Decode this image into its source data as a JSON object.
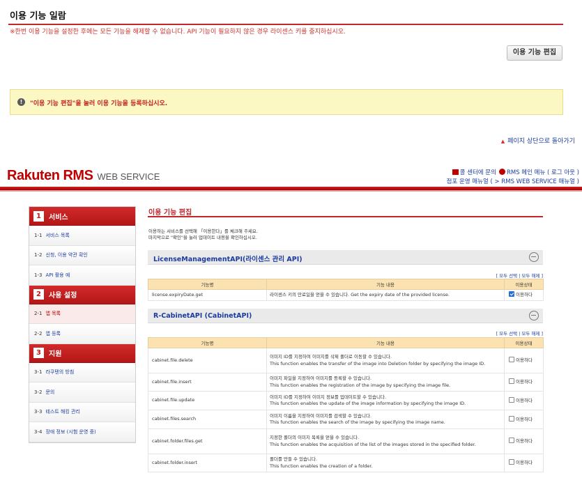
{
  "top": {
    "title": "이용 기능 일람",
    "warning": "※한번 이용 기능을 설정한 후에는 모든 기능을 해제할 수 없습니다. API 기능이 필요하지 않은 경우 라이센스 키를 중지하십시오.",
    "edit_button": "이용 기능 편집",
    "notice": "\"이용 기능 편집\"을 눌러 이용 기능을 등록하십시오.",
    "back_to_top": "페이지 상단으로 돌아가기"
  },
  "header": {
    "logo_main": "Rakuten RMS",
    "logo_sub": "WEB SERVICE",
    "link_callcenter": "콜 센터에 문의",
    "link_rms_main": "RMS 메인 메뉴 ( 로그 아웃 )",
    "link_manual": "점포 운영 매뉴얼",
    "link_ws_manual": "( > RMS WEB SERVICE 매뉴얼 )",
    "accent_color": "#bf0000"
  },
  "sidebar": {
    "sections": [
      {
        "num": "1",
        "title": "서비스",
        "items": [
          {
            "num": "1-1",
            "label": "서비스 목록"
          },
          {
            "num": "1-2",
            "label": "신청, 이용 약관 확인"
          },
          {
            "num": "1-3",
            "label": "API 활용 예"
          }
        ]
      },
      {
        "num": "2",
        "title": "사용 설정",
        "items": [
          {
            "num": "2-1",
            "label": "앱 목록"
          },
          {
            "num": "2-2",
            "label": "앱 등록"
          }
        ]
      },
      {
        "num": "3",
        "title": "지원",
        "items": [
          {
            "num": "3-1",
            "label": "라쿠텐의 방침"
          },
          {
            "num": "3-2",
            "label": "문의"
          },
          {
            "num": "3-3",
            "label": "테스트 해킹 관리"
          },
          {
            "num": "3-4",
            "label": "장애 정보 (시험 운영 중)"
          }
        ]
      }
    ]
  },
  "main": {
    "title": "이용 기능 편집",
    "intro_line1": "이용하는 서비스를 선택해 「이용한다」를 체크해 주세요.",
    "intro_line2": "마지막으로 \"확인\"을 눌러 업데이트 내용을 확인하십시오.",
    "select_links": "[ 모두 선택 | 모두 해제 ]",
    "col_function": "기능명",
    "col_desc": "기능 내용",
    "col_status": "이용상태",
    "use_label": "이용하다",
    "apis": [
      {
        "name": "LicenseManagementAPI(라이센스 관리 API)",
        "rows": [
          {
            "fn": "license.expiryDate.get",
            "desc": "라이센스 키의 만료일을 얻을 수 있습니다. Get the expiry date of the provided license.",
            "checked": true
          }
        ]
      },
      {
        "name": "R-CabinetAPI (CabinetAPI)",
        "rows": [
          {
            "fn": "cabinet.file.delete",
            "desc": "이미지 ID를 지정하여 이미지를 삭제 폴더로 이동할 수 있습니다.\nThis function enables the transfer of the image into Deletion folder by specifying the image ID.",
            "checked": false
          },
          {
            "fn": "cabinet.file.insert",
            "desc": "이미지 파일을 지정하여 이미지를 등록할 수 있습니다.\nThis function enables the registration of the image by specifying the image file.",
            "checked": false
          },
          {
            "fn": "cabinet.file.update",
            "desc": "이미지 ID를 지정하여 이미지 정보를 업데이트할 수 있습니다.\nThis function enables the update of the image information by specifying the image ID.",
            "checked": false
          },
          {
            "fn": "cabinet.files.search",
            "desc": "이미지 이름을 지정하여 이미지를 검색할 수 있습니다.\nThis function enables the search of the image by specifying the image name.",
            "checked": false
          },
          {
            "fn": "cabinet.folder.files.get",
            "desc": "지정한 폴더의 이미지 목록을 얻을 수 있습니다.\nThis function enables the acquisition of the list of the images stored in the specified folder.",
            "checked": false
          },
          {
            "fn": "cabinet.folder.insert",
            "desc": "폴더를 만들 수 있습니다.\nThis function enables the creation of a folder.",
            "checked": false
          }
        ]
      }
    ]
  }
}
